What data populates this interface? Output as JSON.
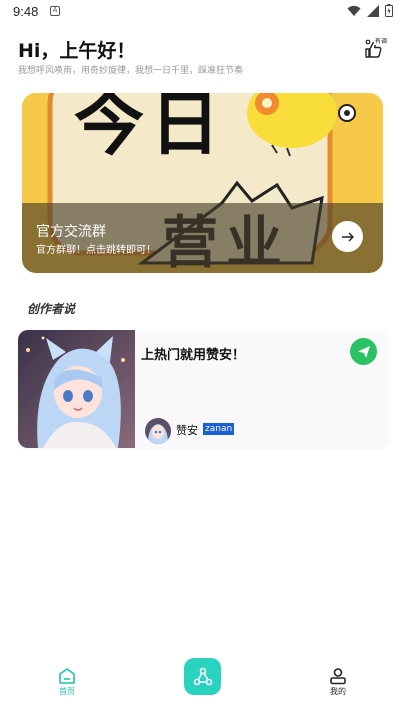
{
  "status_bar": {
    "time": "9:48",
    "notification_glyph": "A"
  },
  "header": {
    "greeting": "Hi，上午好！",
    "subtitle": "我想呼风唤雨，用奇妙旋律，我想一日千里，踩准狂节奏",
    "checkin_label": "有调"
  },
  "banner": {
    "title": "官方交流群",
    "subtitle": "官方群聊！点击跳转即可！",
    "art_text": "今日",
    "art_text_bottom": "营业",
    "art_icon": "duck-mascot-icon"
  },
  "section": {
    "title": "创作者说"
  },
  "card": {
    "title": "上热门就用赞安！",
    "author_name": "赞安",
    "author_tag": "zanan",
    "image_icon": "anime-girl-illustration",
    "send_icon": "send-icon"
  },
  "nav": {
    "home_label": "首页",
    "center_icon": "triangle-nodes-icon",
    "mine_label": "我的"
  },
  "colors": {
    "accent": "#2ad3bf",
    "send": "#2bc266",
    "tag": "#1a5fd6",
    "banner_bg": "#f7c948"
  }
}
